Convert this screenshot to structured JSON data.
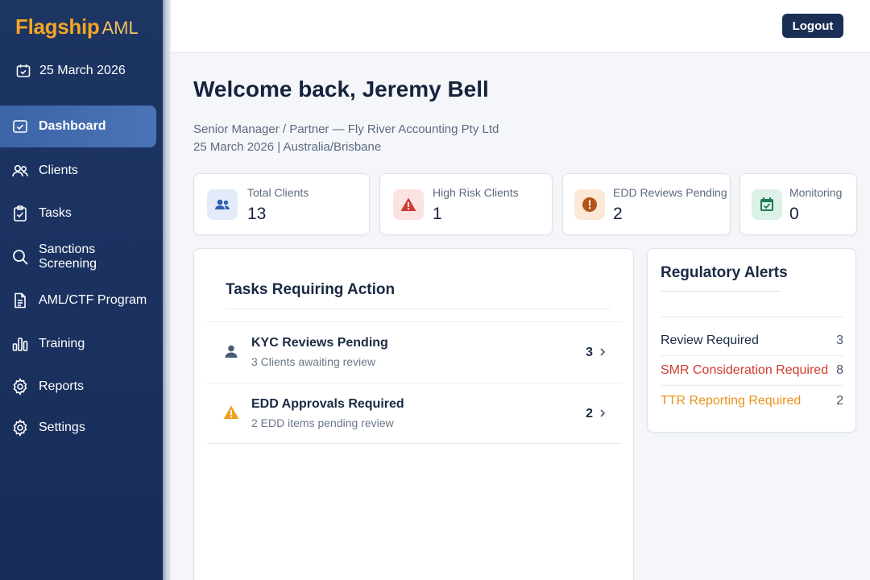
{
  "app": {
    "logo_main": "Flagship",
    "logo_sub": "AML",
    "date": "25 March 2026"
  },
  "sidebar": {
    "items": [
      {
        "label": "Dashboard",
        "icon": "dashboard-check-icon",
        "active": true
      },
      {
        "label": "Clients",
        "icon": "users-icon"
      },
      {
        "label": "Tasks",
        "icon": "clipboard-check-icon"
      },
      {
        "label": "Sanctions Screening",
        "icon": "search-icon"
      },
      {
        "label": "AML/CTF Program",
        "icon": "document-icon"
      },
      {
        "label": "Training",
        "icon": "bar-chart-icon"
      },
      {
        "label": "Reports",
        "icon": "gear-icon"
      },
      {
        "label": "Settings",
        "icon": "gear-icon"
      }
    ]
  },
  "header": {
    "logout_label": "Logout"
  },
  "main": {
    "welcome": "Welcome back, Jeremy Bell",
    "role_line": "Senior Manager / Partner — Fly River Accounting Pty Ltd",
    "date_line": "25 March 2026 | Australia/Brisbane"
  },
  "stats": [
    {
      "label": "Total Clients",
      "value": "13",
      "icon": "users-icon",
      "color": "#2f5fb3",
      "bg": "#e3ebfa"
    },
    {
      "label": "High Risk Clients",
      "value": "1",
      "icon": "warning-icon",
      "color": "#d03a2f",
      "bg": "#fbe3e1"
    },
    {
      "label": "EDD Reviews Pending",
      "value": "2",
      "icon": "alert-circle-icon",
      "color": "#b4541a",
      "bg": "#fbe8d6"
    },
    {
      "label": "Monitoring",
      "value": "0",
      "icon": "calendar-check-icon",
      "color": "#1f7a55",
      "bg": "#dcf1e7"
    }
  ],
  "tasks": {
    "title": "Tasks Requiring Action",
    "rows": [
      {
        "title": "KYC Reviews Pending",
        "subtitle": "3 Clients awaiting review",
        "count": "3",
        "icon": "person-icon"
      },
      {
        "title": "EDD Approvals Required",
        "subtitle": "2 EDD items pending review",
        "count": "2",
        "icon": "warning-icon"
      }
    ]
  },
  "alerts": {
    "title": "Regulatory Alerts",
    "rows": [
      {
        "label": "Review Required",
        "count": "3",
        "color": "#1a2a44"
      },
      {
        "label": "SMR Consideration Required",
        "count": "8",
        "color": "#d03a2f"
      },
      {
        "label": "TTR Reporting Required",
        "count": "2",
        "color": "#e8931a"
      }
    ]
  }
}
